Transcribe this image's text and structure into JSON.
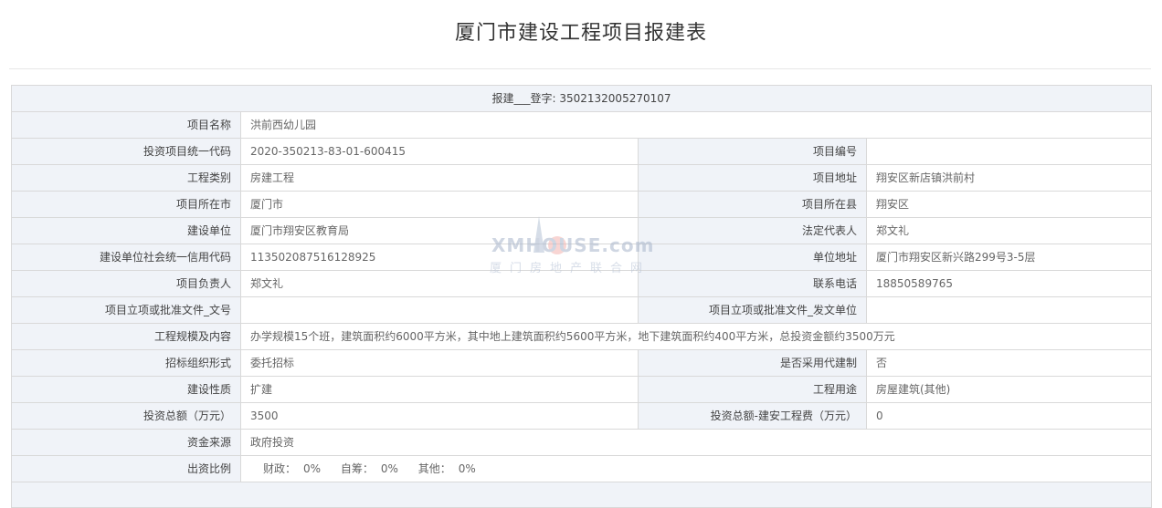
{
  "page": {
    "title": "厦门市建设工程项目报建表"
  },
  "header_row": {
    "text": "报建___登字: 3502132005270107"
  },
  "watermark": {
    "brand": "XMHOUSE.com",
    "subtitle": "厦门房地产联合网"
  },
  "rows": {
    "project_name": {
      "label": "项目名称",
      "value": "洪前西幼儿园"
    },
    "invest_code": {
      "label": "投资项目统一代码",
      "value": "2020-350213-83-01-600415"
    },
    "project_no": {
      "label": "项目编号",
      "value": ""
    },
    "eng_type": {
      "label": "工程类别",
      "value": "房建工程"
    },
    "project_addr": {
      "label": "项目地址",
      "value": "翔安区新店镇洪前村"
    },
    "city": {
      "label": "项目所在市",
      "value": "厦门市"
    },
    "county": {
      "label": "项目所在县",
      "value": "翔安区"
    },
    "build_unit": {
      "label": "建设单位",
      "value": "厦门市翔安区教育局"
    },
    "legal_rep": {
      "label": "法定代表人",
      "value": "郑文礼"
    },
    "credit_code": {
      "label": "建设单位社会统一信用代码",
      "value": "113502087516128925"
    },
    "unit_addr": {
      "label": "单位地址",
      "value": "厦门市翔安区新兴路299号3-5层"
    },
    "manager": {
      "label": "项目负责人",
      "value": "郑文礼"
    },
    "phone": {
      "label": "联系电话",
      "value": "18850589765"
    },
    "approval_no": {
      "label": "项目立项或批准文件_文号",
      "value": ""
    },
    "approval_unit": {
      "label": "项目立项或批准文件_发文单位",
      "value": ""
    },
    "scale": {
      "label": "工程规模及内容",
      "value": "办学规模15个班，建筑面积约6000平方米，其中地上建筑面积约5600平方米，地下建筑面积约400平方米，总投资金额约3500万元"
    },
    "bid_form": {
      "label": "招标组织形式",
      "value": "委托招标"
    },
    "agent_build": {
      "label": "是否采用代建制",
      "value": "否"
    },
    "nature": {
      "label": "建设性质",
      "value": "扩建"
    },
    "usage": {
      "label": "工程用途",
      "value": "房屋建筑(其他)"
    },
    "total_invest": {
      "label": "投资总额（万元）",
      "value": "3500"
    },
    "construct_fee": {
      "label": "投资总额-建安工程费（万元）",
      "value": "0"
    },
    "fund_source": {
      "label": "资金来源",
      "value": "政府投资"
    },
    "ratio": {
      "label": "出资比例",
      "items": [
        {
          "key": "财政：",
          "value": "0%"
        },
        {
          "key": "自筹：",
          "value": "0%"
        },
        {
          "key": "其他：",
          "value": "0%"
        }
      ]
    }
  }
}
